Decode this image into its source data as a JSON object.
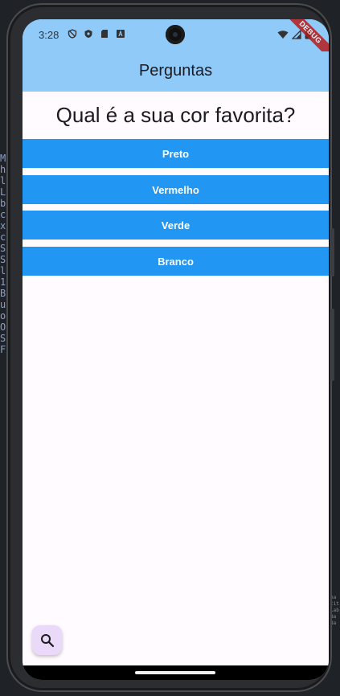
{
  "status_bar": {
    "time": "3:28"
  },
  "debug_banner": "DEBUG",
  "app_bar": {
    "title": "Perguntas"
  },
  "quiz": {
    "question": "Qual é a sua cor favorita?",
    "answers": [
      {
        "label": "Preto"
      },
      {
        "label": "Vermelho"
      },
      {
        "label": "Verde"
      },
      {
        "label": "Branco"
      }
    ]
  },
  "fab": {
    "icon": "search-icon"
  },
  "colors": {
    "app_bar": "#90caf9",
    "button": "#2196f3",
    "button_text": "#ffffff",
    "background": "#fffbfe",
    "fab": "#ead9f9"
  }
}
